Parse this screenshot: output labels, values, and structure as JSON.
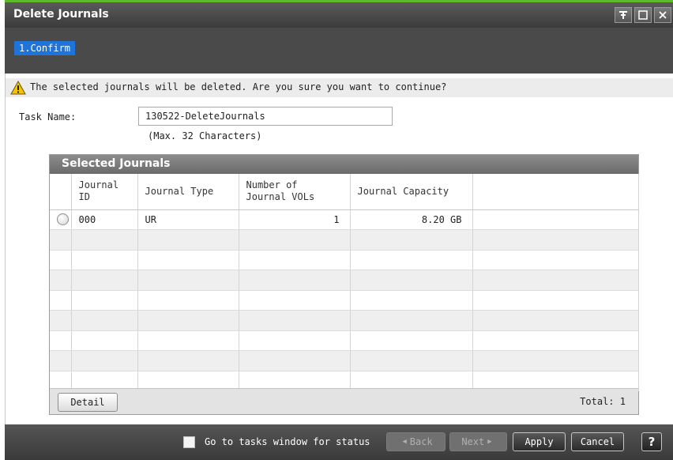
{
  "window": {
    "title": "Delete Journals",
    "controls": {
      "pin_icon": "pin-icon",
      "maximize_icon": "maximize-icon",
      "close_icon": "close-icon"
    }
  },
  "steps": [
    {
      "label": "1.Confirm",
      "active": true
    }
  ],
  "warning": {
    "icon": "warning-icon",
    "text": "The selected journals will be deleted. Are you sure you want to continue?"
  },
  "task": {
    "label": "Task Name:",
    "value": "130522-DeleteJournals",
    "hint": "(Max. 32 Characters)"
  },
  "table": {
    "title": "Selected Journals",
    "columns": [
      "",
      "Journal ID",
      "Journal Type",
      "Number of Journal VOLs",
      "Journal Capacity",
      ""
    ],
    "rows": [
      {
        "journal_id": "000",
        "journal_type": "UR",
        "num_vols": "1",
        "capacity": "8.20 GB"
      }
    ],
    "detail_label": "Detail",
    "total_label": "Total:",
    "total_value": "1"
  },
  "footer": {
    "goto_tasks_label": "Go to tasks window for status",
    "back_label": "Back",
    "next_label": "Next",
    "apply_label": "Apply",
    "cancel_label": "Cancel",
    "help_label": "?"
  },
  "colors": {
    "accent_green": "#5dbb2a",
    "step_blue": "#1e74d8",
    "titlebar": "#4a4a4a"
  }
}
